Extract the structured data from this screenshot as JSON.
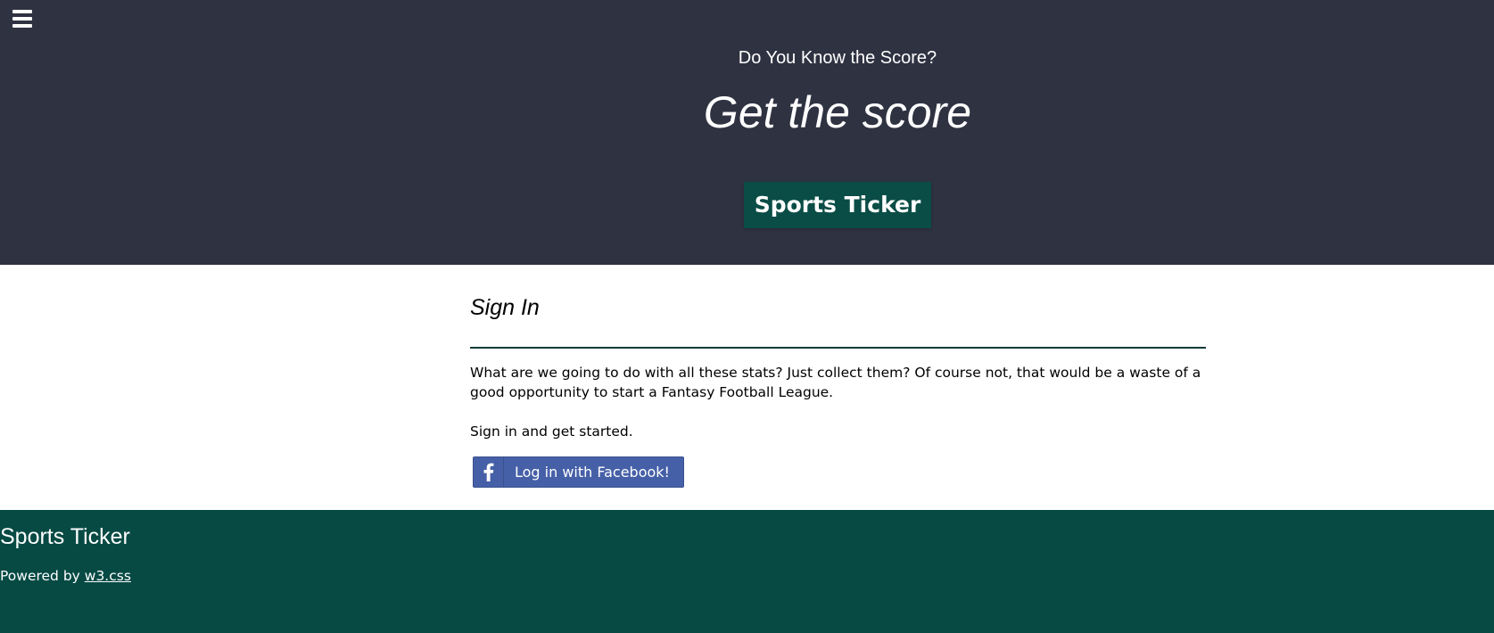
{
  "header": {
    "menu_icon": "hamburger-menu-icon",
    "tagline": "Do You Know the Score?",
    "hero_title": "Get the score",
    "ticker_button_label": "Sports Ticker",
    "background_color": "#2f3241",
    "button_color": "#0a4d46"
  },
  "signin": {
    "title": "Sign In",
    "paragraph_1": "What are we going to do with all these stats? Just collect them? Of course not, that would be a waste of a good opportunity to start a Fantasy Football League.",
    "paragraph_2": "Sign in and get started.",
    "facebook_button_label": "Log in with Facebook!",
    "facebook_icon": "facebook-f-icon",
    "facebook_color": "#4660a8"
  },
  "footer": {
    "title": "Sports Ticker",
    "powered_by_prefix": "Powered by ",
    "powered_by_link": "w3.css",
    "background_color": "#074a44"
  }
}
